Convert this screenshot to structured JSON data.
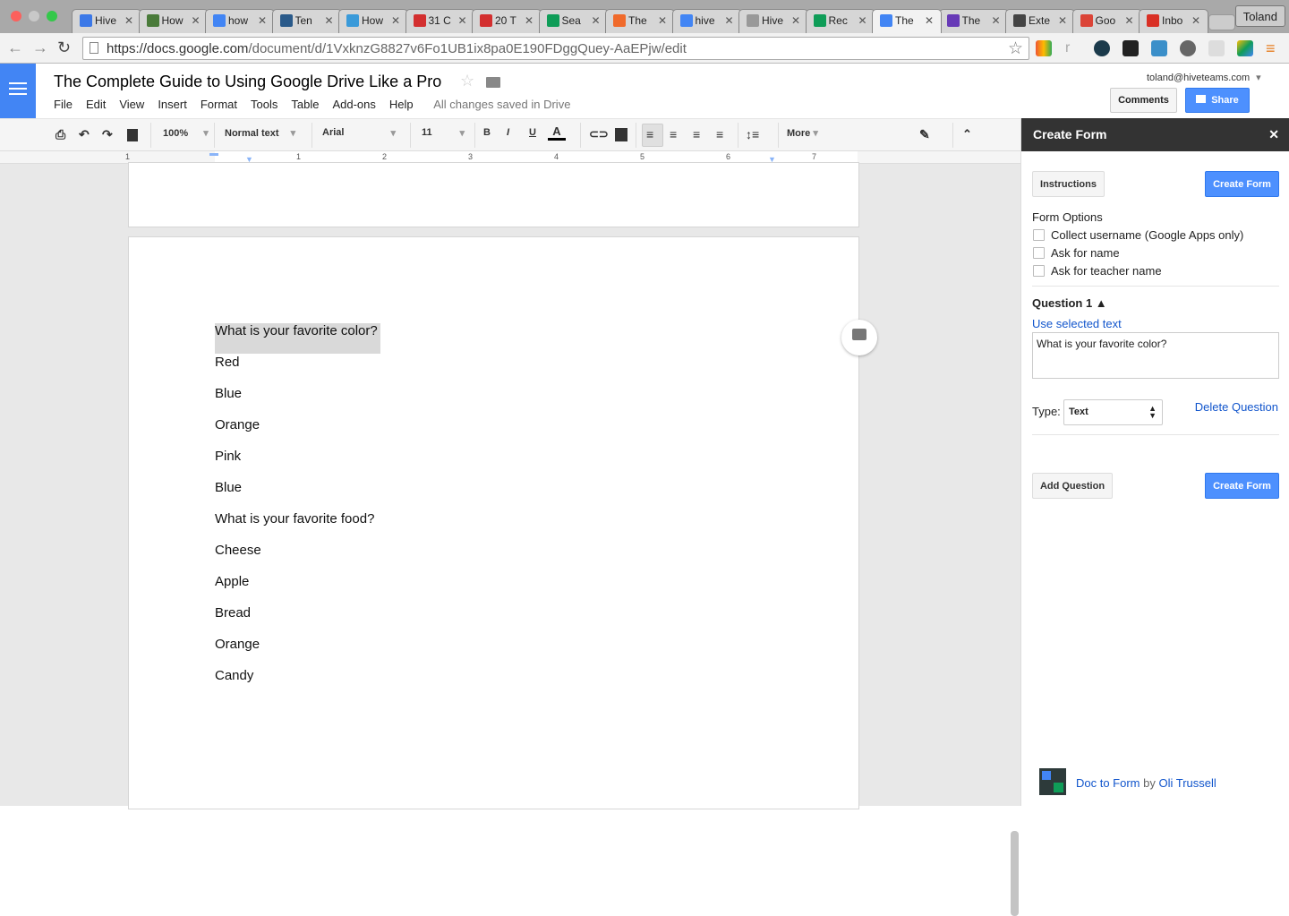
{
  "browser": {
    "tabs": [
      {
        "label": "Hive",
        "color": "#3b78e7"
      },
      {
        "label": "How",
        "color": "#4a7b3a"
      },
      {
        "label": "how",
        "color": "#4285f4"
      },
      {
        "label": "Ten",
        "color": "#2a5a8a"
      },
      {
        "label": "How",
        "color": "#3a9ad9"
      },
      {
        "label": "31 C",
        "color": "#d32f2f"
      },
      {
        "label": "20 T",
        "color": "#d32f2f"
      },
      {
        "label": "Sea",
        "color": "#0f9d58"
      },
      {
        "label": "The",
        "color": "#f06a2b"
      },
      {
        "label": "hive",
        "color": "#4285f4"
      },
      {
        "label": "Hive",
        "color": "#999999"
      },
      {
        "label": "Rec",
        "color": "#0f9d58"
      },
      {
        "label": "The",
        "color": "#4285f4"
      },
      {
        "label": "The",
        "color": "#673ab7"
      },
      {
        "label": "Exte",
        "color": "#444444"
      },
      {
        "label": "Goo",
        "color": "#db4437"
      },
      {
        "label": "Inbo",
        "color": "#d93025"
      }
    ],
    "active_tab": 12,
    "profile": "Toland",
    "url_host": "https://docs.google.com",
    "url_path": "/document/d/1VxknzG8827v6Fo1UB1ix8pa0E190FDggQuey-AaEPjw/edit"
  },
  "doc": {
    "title": "The Complete Guide to Using Google Drive Like a Pro",
    "menu": [
      "File",
      "Edit",
      "View",
      "Insert",
      "Format",
      "Tools",
      "Table",
      "Add-ons",
      "Help"
    ],
    "saved": "All changes saved in Drive",
    "email": "toland@hiveteams.com",
    "comments": "Comments",
    "share": "Share",
    "toolbar": {
      "zoom": "100%",
      "style": "Normal text",
      "font": "Arial",
      "size": "11",
      "bold": "B",
      "italic": "I",
      "underline": "U",
      "color": "A",
      "more": "More"
    },
    "ruler": [
      "1",
      "1",
      "2",
      "3",
      "4",
      "5",
      "6",
      "7"
    ],
    "lines": [
      "What is your favorite color?",
      "Red",
      "Blue",
      "Orange",
      "Pink",
      "Blue",
      "What is your favorite food?",
      "Cheese",
      "Apple",
      "Bread",
      "Orange",
      "Candy"
    ]
  },
  "sidebar": {
    "title": "Create Form",
    "close": "✕",
    "instructions": "Instructions",
    "create_form": "Create Form",
    "form_options": "Form Options",
    "options": [
      "Collect username (Google Apps only)",
      "Ask for name",
      "Ask for teacher name"
    ],
    "question_label": "Question 1 ▲",
    "use_selected": "Use selected text",
    "question_text": "What is your favorite color?",
    "type_label": "Type:",
    "type_value": "Text",
    "delete": "Delete Question",
    "add_question": "Add Question",
    "create_form2": "Create Form",
    "footer_link1": "Doc to Form",
    "footer_by": "by",
    "footer_link2": "Oli Trussell"
  }
}
